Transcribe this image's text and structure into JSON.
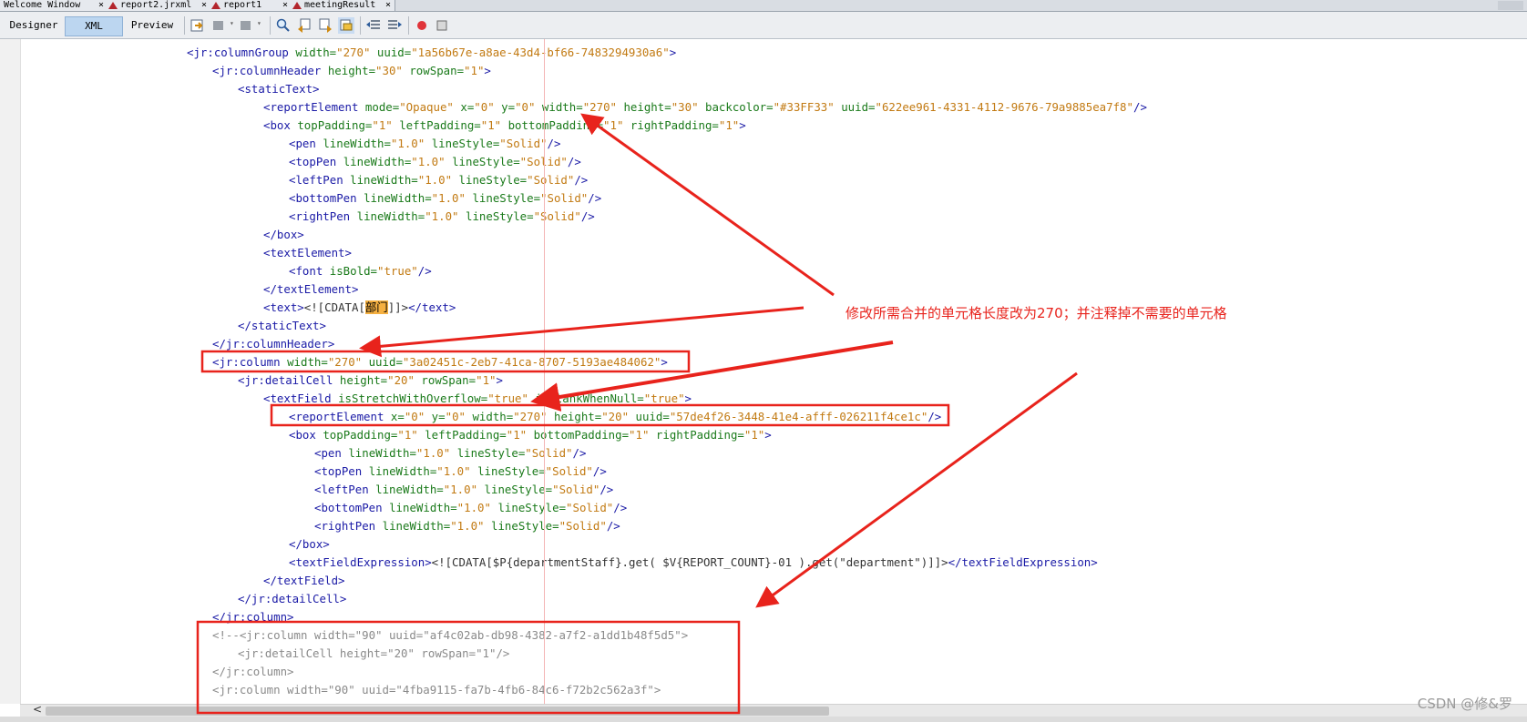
{
  "tabs": [
    {
      "label": "Welcome Window",
      "close": "×"
    },
    {
      "label": "report2.jrxml",
      "close": "×"
    },
    {
      "label": "report1",
      "close": "×"
    },
    {
      "label": "meetingResult",
      "close": "×"
    }
  ],
  "views": {
    "designer": "Designer",
    "xml": "XML",
    "preview": "Preview",
    "active": "XML"
  },
  "toolbar_icons": [
    "last-edit-icon",
    "back-icon",
    "forward-icon",
    "find-icon",
    "find-previous-icon",
    "find-next-icon",
    "toggle-highlight-icon",
    "shift-left-icon",
    "shift-right-icon",
    "record-macro-icon",
    "stop-macro-icon"
  ],
  "code_lines": [
    [
      {
        "c": "t",
        "s": "<jr:columnGroup "
      },
      {
        "c": "a",
        "s": "width="
      },
      {
        "c": "v",
        "s": "\"270\""
      },
      {
        "c": "a",
        "s": " uuid="
      },
      {
        "c": "v",
        "s": "\"1a56b67e-a8ae-43d4-bf66-7483294930a6\""
      },
      {
        "c": "t",
        "s": ">"
      }
    ],
    [
      {
        "c": "t",
        "s": "<jr:columnHeader "
      },
      {
        "c": "a",
        "s": "height="
      },
      {
        "c": "v",
        "s": "\"30\""
      },
      {
        "c": "a",
        "s": " rowSpan="
      },
      {
        "c": "v",
        "s": "\"1\""
      },
      {
        "c": "t",
        "s": ">"
      }
    ],
    [
      {
        "c": "t",
        "s": "<staticText>"
      }
    ],
    [
      {
        "c": "t",
        "s": "<reportElement "
      },
      {
        "c": "a",
        "s": "mode="
      },
      {
        "c": "v",
        "s": "\"Opaque\""
      },
      {
        "c": "a",
        "s": " x="
      },
      {
        "c": "v",
        "s": "\"0\""
      },
      {
        "c": "a",
        "s": " y="
      },
      {
        "c": "v",
        "s": "\"0\""
      },
      {
        "c": "a",
        "s": " width="
      },
      {
        "c": "v",
        "s": "\"270\""
      },
      {
        "c": "a",
        "s": " height="
      },
      {
        "c": "v",
        "s": "\"30\""
      },
      {
        "c": "a",
        "s": " backcolor="
      },
      {
        "c": "v",
        "s": "\"#33FF33\""
      },
      {
        "c": "a",
        "s": " uuid="
      },
      {
        "c": "v",
        "s": "\"622ee961-4331-4112-9676-79a9885ea7f8\""
      },
      {
        "c": "t",
        "s": "/>"
      }
    ],
    [
      {
        "c": "t",
        "s": "<box "
      },
      {
        "c": "a",
        "s": "topPadding="
      },
      {
        "c": "v",
        "s": "\"1\""
      },
      {
        "c": "a",
        "s": " leftPadding="
      },
      {
        "c": "v",
        "s": "\"1\""
      },
      {
        "c": "a",
        "s": " bottomPadding="
      },
      {
        "c": "v",
        "s": "\"1\""
      },
      {
        "c": "a",
        "s": " rightPadding="
      },
      {
        "c": "v",
        "s": "\"1\""
      },
      {
        "c": "t",
        "s": ">"
      }
    ],
    [
      {
        "c": "t",
        "s": "<pen "
      },
      {
        "c": "a",
        "s": "lineWidth="
      },
      {
        "c": "v",
        "s": "\"1.0\""
      },
      {
        "c": "a",
        "s": " lineStyle="
      },
      {
        "c": "v",
        "s": "\"Solid\""
      },
      {
        "c": "t",
        "s": "/>"
      }
    ],
    [
      {
        "c": "t",
        "s": "<topPen "
      },
      {
        "c": "a",
        "s": "lineWidth="
      },
      {
        "c": "v",
        "s": "\"1.0\""
      },
      {
        "c": "a",
        "s": " lineStyle="
      },
      {
        "c": "v",
        "s": "\"Solid\""
      },
      {
        "c": "t",
        "s": "/>"
      }
    ],
    [
      {
        "c": "t",
        "s": "<leftPen "
      },
      {
        "c": "a",
        "s": "lineWidth="
      },
      {
        "c": "v",
        "s": "\"1.0\""
      },
      {
        "c": "a",
        "s": " lineStyle="
      },
      {
        "c": "v",
        "s": "\"Solid\""
      },
      {
        "c": "t",
        "s": "/>"
      }
    ],
    [
      {
        "c": "t",
        "s": "<bottomPen "
      },
      {
        "c": "a",
        "s": "lineWidth="
      },
      {
        "c": "v",
        "s": "\"1.0\""
      },
      {
        "c": "a",
        "s": " lineStyle="
      },
      {
        "c": "v",
        "s": "\"Solid\""
      },
      {
        "c": "t",
        "s": "/>"
      }
    ],
    [
      {
        "c": "t",
        "s": "<rightPen "
      },
      {
        "c": "a",
        "s": "lineWidth="
      },
      {
        "c": "v",
        "s": "\"1.0\""
      },
      {
        "c": "a",
        "s": " lineStyle="
      },
      {
        "c": "v",
        "s": "\"Solid\""
      },
      {
        "c": "t",
        "s": "/>"
      }
    ],
    [
      {
        "c": "t",
        "s": "</box>"
      }
    ],
    [
      {
        "c": "t",
        "s": "<textElement>"
      }
    ],
    [
      {
        "c": "t",
        "s": "<font "
      },
      {
        "c": "a",
        "s": "isBold="
      },
      {
        "c": "v",
        "s": "\"true\""
      },
      {
        "c": "t",
        "s": "/>"
      }
    ],
    [
      {
        "c": "t",
        "s": "</textElement>"
      }
    ],
    [
      {
        "c": "t",
        "s": "<text>"
      },
      {
        "c": "p",
        "s": "<![CDATA["
      },
      {
        "c": "hl",
        "s": "部门"
      },
      {
        "c": "p",
        "s": "]]>"
      },
      {
        "c": "t",
        "s": "</text>"
      }
    ],
    [
      {
        "c": "t",
        "s": "</staticText>"
      }
    ],
    [
      {
        "c": "t",
        "s": "</jr:columnHeader>"
      }
    ],
    [
      {
        "c": "t",
        "s": "<jr:column "
      },
      {
        "c": "a",
        "s": "width="
      },
      {
        "c": "v",
        "s": "\"270\""
      },
      {
        "c": "a",
        "s": " uuid="
      },
      {
        "c": "v",
        "s": "\"3a02451c-2eb7-41ca-8707-5193ae484062\""
      },
      {
        "c": "t",
        "s": ">"
      }
    ],
    [
      {
        "c": "t",
        "s": "<jr:detailCell "
      },
      {
        "c": "a",
        "s": "height="
      },
      {
        "c": "v",
        "s": "\"20\""
      },
      {
        "c": "a",
        "s": " rowSpan="
      },
      {
        "c": "v",
        "s": "\"1\""
      },
      {
        "c": "t",
        "s": ">"
      }
    ],
    [
      {
        "c": "t",
        "s": "<textField "
      },
      {
        "c": "a",
        "s": "isStretchWithOverflow="
      },
      {
        "c": "v",
        "s": "\"true\""
      },
      {
        "c": "a",
        "s": " isBlankWhenNull="
      },
      {
        "c": "v",
        "s": "\"true\""
      },
      {
        "c": "t",
        "s": ">"
      }
    ],
    [
      {
        "c": "t",
        "s": "<reportElement "
      },
      {
        "c": "a",
        "s": "x="
      },
      {
        "c": "v",
        "s": "\"0\""
      },
      {
        "c": "a",
        "s": " y="
      },
      {
        "c": "v",
        "s": "\"0\""
      },
      {
        "c": "a",
        "s": " width="
      },
      {
        "c": "v",
        "s": "\"270\""
      },
      {
        "c": "a",
        "s": " height="
      },
      {
        "c": "v",
        "s": "\"20\""
      },
      {
        "c": "a",
        "s": " uuid="
      },
      {
        "c": "v",
        "s": "\"57de4f26-3448-41e4-afff-026211f4ce1c\""
      },
      {
        "c": "t",
        "s": "/>"
      }
    ],
    [
      {
        "c": "t",
        "s": "<box "
      },
      {
        "c": "a",
        "s": "topPadding="
      },
      {
        "c": "v",
        "s": "\"1\""
      },
      {
        "c": "a",
        "s": " leftPadding="
      },
      {
        "c": "v",
        "s": "\"1\""
      },
      {
        "c": "a",
        "s": " bottomPadding="
      },
      {
        "c": "v",
        "s": "\"1\""
      },
      {
        "c": "a",
        "s": " rightPadding="
      },
      {
        "c": "v",
        "s": "\"1\""
      },
      {
        "c": "t",
        "s": ">"
      }
    ],
    [
      {
        "c": "t",
        "s": "<pen "
      },
      {
        "c": "a",
        "s": "lineWidth="
      },
      {
        "c": "v",
        "s": "\"1.0\""
      },
      {
        "c": "a",
        "s": " lineStyle="
      },
      {
        "c": "v",
        "s": "\"Solid\""
      },
      {
        "c": "t",
        "s": "/>"
      }
    ],
    [
      {
        "c": "t",
        "s": "<topPen "
      },
      {
        "c": "a",
        "s": "lineWidth="
      },
      {
        "c": "v",
        "s": "\"1.0\""
      },
      {
        "c": "a",
        "s": " lineStyle="
      },
      {
        "c": "v",
        "s": "\"Solid\""
      },
      {
        "c": "t",
        "s": "/>"
      }
    ],
    [
      {
        "c": "t",
        "s": "<leftPen "
      },
      {
        "c": "a",
        "s": "lineWidth="
      },
      {
        "c": "v",
        "s": "\"1.0\""
      },
      {
        "c": "a",
        "s": " lineStyle="
      },
      {
        "c": "v",
        "s": "\"Solid\""
      },
      {
        "c": "t",
        "s": "/>"
      }
    ],
    [
      {
        "c": "t",
        "s": "<bottomPen "
      },
      {
        "c": "a",
        "s": "lineWidth="
      },
      {
        "c": "v",
        "s": "\"1.0\""
      },
      {
        "c": "a",
        "s": " lineStyle="
      },
      {
        "c": "v",
        "s": "\"Solid\""
      },
      {
        "c": "t",
        "s": "/>"
      }
    ],
    [
      {
        "c": "t",
        "s": "<rightPen "
      },
      {
        "c": "a",
        "s": "lineWidth="
      },
      {
        "c": "v",
        "s": "\"1.0\""
      },
      {
        "c": "a",
        "s": " lineStyle="
      },
      {
        "c": "v",
        "s": "\"Solid\""
      },
      {
        "c": "t",
        "s": "/>"
      }
    ],
    [
      {
        "c": "t",
        "s": "</box>"
      }
    ],
    [
      {
        "c": "t",
        "s": "<textFieldExpression>"
      },
      {
        "c": "p",
        "s": "<![CDATA[$P{departmentStaff}.get( $V{REPORT_COUNT}-01 ).get(\"department\")]]>"
      },
      {
        "c": "t",
        "s": "</textFieldExpression>"
      }
    ],
    [
      {
        "c": "t",
        "s": "</textField>"
      }
    ],
    [
      {
        "c": "t",
        "s": "</jr:detailCell>"
      }
    ],
    [
      {
        "c": "t",
        "s": "</jr:column>"
      }
    ],
    [
      {
        "c": "c",
        "s": "<!--<jr:column width=\"90\" uuid=\"af4c02ab-db98-4382-a7f2-a1dd1b48f5d5\">"
      }
    ],
    [
      {
        "c": "c",
        "s": "<jr:detailCell height=\"20\" rowSpan=\"1\"/>"
      }
    ],
    [
      {
        "c": "c",
        "s": "</jr:column>"
      }
    ],
    [
      {
        "c": "c",
        "s": "<jr:column width=\"90\" uuid=\"4fba9115-fa7b-4fb6-84c6-f72b2c562a3f\">"
      }
    ]
  ],
  "annotation": "修改所需合并的单元格长度改为270；并注释掉不需要的单元格",
  "scroll_left_label": "<",
  "watermark": "CSDN @修&罗",
  "colors": {
    "annotation": "#e8231c",
    "tag": "#1a1aa6",
    "attribute": "#1a7a1a",
    "value": "#c27a12",
    "comment": "#8a8a8a",
    "highlight": "#f5b041"
  }
}
